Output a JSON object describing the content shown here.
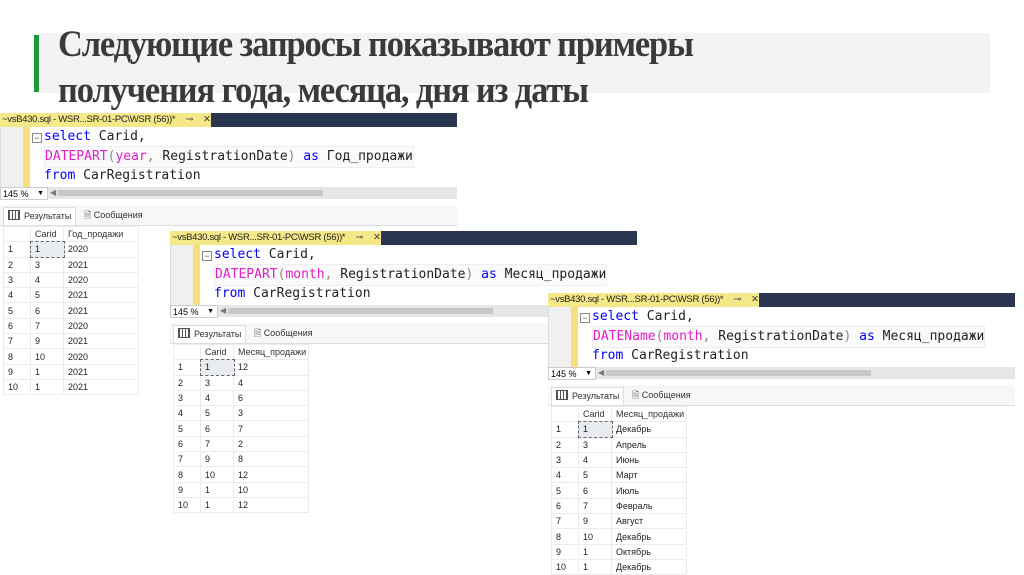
{
  "slide": {
    "title_line1": "Следующие запросы показывают примеры",
    "title_line2": "получения года, месяца, дня из даты",
    "accent_color": "#1a9c3a"
  },
  "panels": [
    {
      "tab_title": "~vsB430.sql - WSR...SR-01-PC\\WSR (56))*",
      "code": {
        "line1": {
          "kw": "select",
          "rest": " Carid,"
        },
        "line2": {
          "fn": "DATEPART",
          "open": "(",
          "arg": "year",
          "comma": ",",
          "rest": " RegistrationDate",
          "close": ")",
          "as": " as",
          "alias": " Год_продажи"
        },
        "line3": {
          "kw": "from",
          "rest": " CarRegistration"
        }
      },
      "zoom": "145 %",
      "results_tab": "Результаты",
      "messages_tab": "Сообщения",
      "columns": [
        "",
        "Carid",
        "Год_продажи"
      ],
      "rows": [
        [
          "1",
          "1",
          "2020"
        ],
        [
          "2",
          "3",
          "2021"
        ],
        [
          "3",
          "4",
          "2020"
        ],
        [
          "4",
          "5",
          "2021"
        ],
        [
          "5",
          "6",
          "2021"
        ],
        [
          "6",
          "7",
          "2020"
        ],
        [
          "7",
          "9",
          "2021"
        ],
        [
          "8",
          "10",
          "2020"
        ],
        [
          "9",
          "1",
          "2021"
        ],
        [
          "10",
          "1",
          "2021"
        ]
      ]
    },
    {
      "tab_title": "~vsB430.sql - WSR...SR-01-PC\\WSR (56))*",
      "code": {
        "line1": {
          "kw": "select",
          "rest": " Carid,"
        },
        "line2": {
          "fn": "DATEPART",
          "open": "(",
          "arg": "month",
          "comma": ",",
          "rest": " RegistrationDate",
          "close": ")",
          "as": " as",
          "alias": " Месяц_продажи"
        },
        "line3": {
          "kw": "from",
          "rest": " CarRegistration"
        }
      },
      "zoom": "145 %",
      "results_tab": "Результаты",
      "messages_tab": "Сообщения",
      "columns": [
        "",
        "Carid",
        "Месяц_продажи"
      ],
      "rows": [
        [
          "1",
          "1",
          "12"
        ],
        [
          "2",
          "3",
          "4"
        ],
        [
          "3",
          "4",
          "6"
        ],
        [
          "4",
          "5",
          "3"
        ],
        [
          "5",
          "6",
          "7"
        ],
        [
          "6",
          "7",
          "2"
        ],
        [
          "7",
          "9",
          "8"
        ],
        [
          "8",
          "10",
          "12"
        ],
        [
          "9",
          "1",
          "10"
        ],
        [
          "10",
          "1",
          "12"
        ]
      ]
    },
    {
      "tab_title": "~vsB430.sql - WSR...SR-01-PC\\WSR (56))*",
      "code": {
        "line1": {
          "kw": "select",
          "rest": " Carid,"
        },
        "line2": {
          "fn": "DATEName",
          "open": "(",
          "arg": "month",
          "comma": ",",
          "rest": " RegistrationDate",
          "close": ")",
          "as": " as",
          "alias": " Месяц_продажи"
        },
        "line3": {
          "kw": "from",
          "rest": " CarRegistration"
        }
      },
      "zoom": "145 %",
      "results_tab": "Результаты",
      "messages_tab": "Сообщения",
      "columns": [
        "",
        "Carid",
        "Месяц_продажи"
      ],
      "rows": [
        [
          "1",
          "1",
          "Декабрь"
        ],
        [
          "2",
          "3",
          "Апрель"
        ],
        [
          "3",
          "4",
          "Июнь"
        ],
        [
          "4",
          "5",
          "Март"
        ],
        [
          "5",
          "6",
          "Июль"
        ],
        [
          "6",
          "7",
          "Февраль"
        ],
        [
          "7",
          "9",
          "Август"
        ],
        [
          "8",
          "10",
          "Декабрь"
        ],
        [
          "9",
          "1",
          "Октябрь"
        ],
        [
          "10",
          "1",
          "Декабрь"
        ]
      ]
    }
  ]
}
